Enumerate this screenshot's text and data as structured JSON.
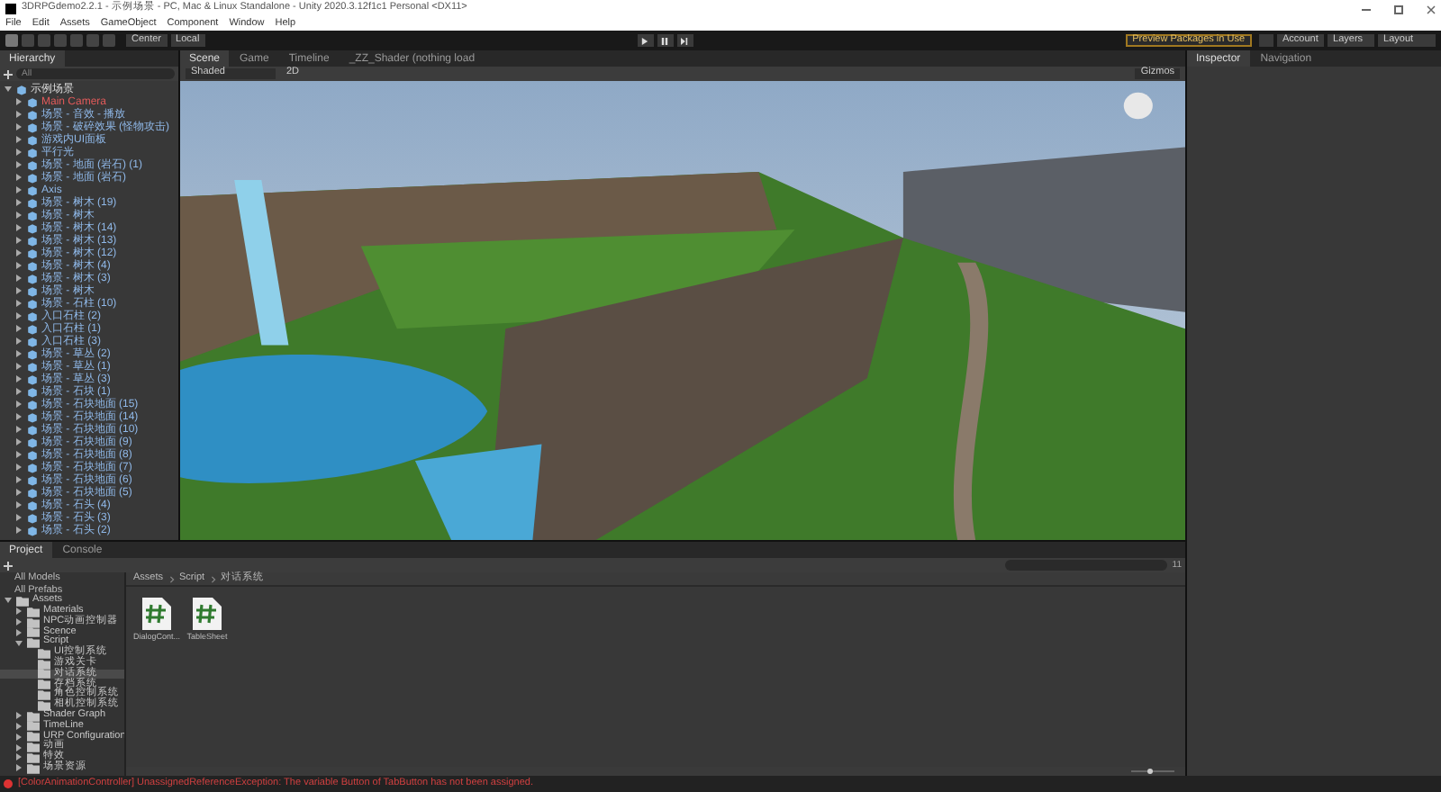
{
  "window": {
    "title": "3DRPGdemo2.2.1 - 示例场景 - PC, Mac & Linux Standalone - Unity 2020.3.12f1c1 Personal <DX11>"
  },
  "menu": [
    "File",
    "Edit",
    "Assets",
    "GameObject",
    "Component",
    "Window",
    "Help"
  ],
  "toolbar": {
    "pivot": "Center",
    "space": "Local",
    "packages": "Preview Packages in Use",
    "account": "Account",
    "layers": "Layers",
    "layout": "Layout"
  },
  "hierarchy": {
    "tab": "Hierarchy",
    "search": "All",
    "items": [
      {
        "label": "示例场景",
        "expanded": true,
        "children": [
          {
            "label": "Main Camera",
            "expanded": false
          },
          {
            "label": "场景 - 音效 - 播放",
            "expanded": false
          },
          {
            "label": "场景 - 破碎效果 (怪物攻击)",
            "expanded": false
          },
          {
            "label": "游戏内UI面板",
            "expanded": false
          },
          {
            "label": "平行光",
            "expanded": false
          },
          {
            "label": "场景 - 地面 (岩石) (1)",
            "expanded": false
          },
          {
            "label": "场景 - 地面 (岩石)",
            "expanded": false
          },
          {
            "label": "Axis",
            "expanded": false
          },
          {
            "label": "场景 - 树木 (19)",
            "expanded": false
          },
          {
            "label": "场景 - 树木",
            "expanded": false
          },
          {
            "label": "场景 - 树木 (14)",
            "expanded": false
          },
          {
            "label": "场景 - 树木 (13)",
            "expanded": false
          },
          {
            "label": "场景 - 树木 (12)",
            "expanded": false
          },
          {
            "label": "场景 - 树木 (4)",
            "expanded": false
          },
          {
            "label": "场景 - 树木 (3)",
            "expanded": false
          },
          {
            "label": "场景 - 树木",
            "expanded": false
          },
          {
            "label": "场景 - 石柱 (10)",
            "expanded": false
          },
          {
            "label": "入口石柱 (2)",
            "expanded": false
          },
          {
            "label": "入口石柱 (1)",
            "expanded": false
          },
          {
            "label": "入口石柱 (3)",
            "expanded": false
          },
          {
            "label": "场景 - 草丛 (2)",
            "expanded": false
          },
          {
            "label": "场景 - 草丛 (1)",
            "expanded": false
          },
          {
            "label": "场景 - 草丛 (3)",
            "expanded": false
          },
          {
            "label": "场景 - 石块 (1)",
            "expanded": false
          },
          {
            "label": "场景 - 石块地面 (15)",
            "expanded": false
          },
          {
            "label": "场景 - 石块地面 (14)",
            "expanded": false
          },
          {
            "label": "场景 - 石块地面 (10)",
            "expanded": false
          },
          {
            "label": "场景 - 石块地面 (9)",
            "expanded": false
          },
          {
            "label": "场景 - 石块地面 (8)",
            "expanded": false
          },
          {
            "label": "场景 - 石块地面 (7)",
            "expanded": false
          },
          {
            "label": "场景 - 石块地面 (6)",
            "expanded": false
          },
          {
            "label": "场景 - 石块地面 (5)",
            "expanded": false
          },
          {
            "label": "场景 - 石头 (4)",
            "expanded": false
          },
          {
            "label": "场景 - 石头 (3)",
            "expanded": false
          },
          {
            "label": "场景 - 石头 (2)",
            "expanded": false
          }
        ]
      }
    ]
  },
  "scene": {
    "tabs": [
      {
        "label": "Scene",
        "selected": true
      },
      {
        "label": "Game",
        "selected": false
      },
      {
        "label": "Timeline",
        "selected": false
      },
      {
        "label": "_ZZ_Shader (nothing load",
        "selected": false
      }
    ],
    "shading": "Shaded",
    "gizmos": "Gizmos",
    "mode": "2D"
  },
  "inspector": {
    "tabs": [
      {
        "label": "Inspector",
        "selected": true
      },
      {
        "label": "Navigation",
        "selected": false
      }
    ]
  },
  "project": {
    "tabs": [
      {
        "label": "Project",
        "selected": true
      },
      {
        "label": "Console",
        "selected": false
      }
    ],
    "favorites": [
      "All Models",
      "All Prefabs"
    ],
    "tree": [
      {
        "label": "Assets",
        "expanded": true,
        "children": [
          {
            "label": "Materials",
            "expanded": false
          },
          {
            "label": "NPC动画控制器",
            "expanded": false
          },
          {
            "label": "Scence",
            "expanded": false
          },
          {
            "label": "Script",
            "expanded": true,
            "children": [
              {
                "label": "UI控制系统",
                "selected": false
              },
              {
                "label": "游戏关卡",
                "selected": false
              },
              {
                "label": "对话系统",
                "selected": true
              },
              {
                "label": "存档系统",
                "selected": false
              },
              {
                "label": "角色控制系统",
                "selected": false
              },
              {
                "label": "相机控制系统",
                "selected": false
              }
            ]
          },
          {
            "label": "Shader Graph",
            "expanded": false
          },
          {
            "label": "TimeLine",
            "expanded": false
          },
          {
            "label": "URP Configuration",
            "expanded": false
          },
          {
            "label": "动画",
            "expanded": false
          },
          {
            "label": "特效",
            "expanded": false
          },
          {
            "label": "场景资源",
            "expanded": false
          }
        ]
      }
    ],
    "breadcrumb": [
      "Assets",
      "Script",
      "对话系统"
    ],
    "files": [
      "DialogCont...",
      "TableSheet"
    ],
    "hidden_count": "11",
    "zoom_slider": {
      "level": 0.45
    }
  },
  "status": {
    "message": "[ColorAnimationController] UnassignedReferenceException: The variable Button of TabButton has not been assigned."
  }
}
